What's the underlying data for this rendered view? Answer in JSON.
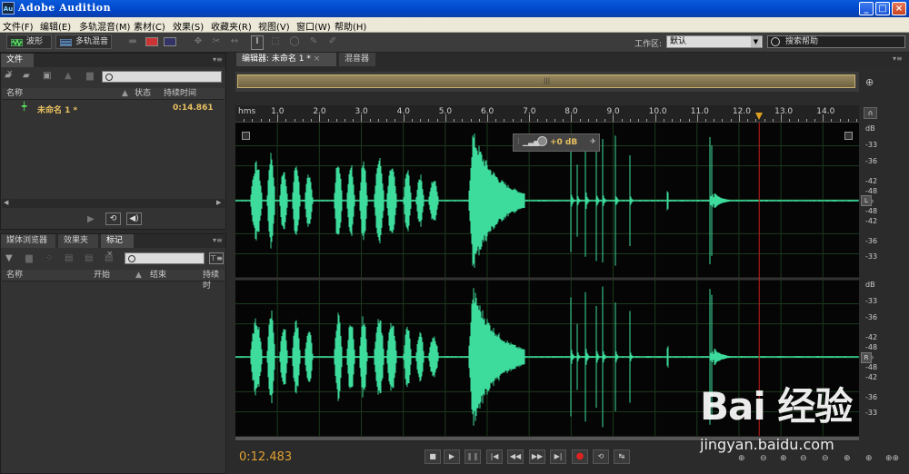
{
  "window": {
    "icon_text": "Au",
    "title": "Adobe Audition",
    "minimize_label": "_",
    "maximize_label": "□",
    "close_label": "×"
  },
  "menu": [
    "文件(F)",
    "编辑(E)",
    "多轨混音(M)",
    "素材(C)",
    "效果(S)",
    "收藏夹(R)",
    "视图(V)",
    "窗口(W)",
    "帮助(H)"
  ],
  "toolbar": {
    "waveform_label": "波形",
    "multitrack_label": "多轨混音",
    "workspace_label": "工作区:",
    "workspace_value": "默认",
    "help_search": "搜索帮助"
  },
  "files_panel": {
    "tab": "文件",
    "columns": [
      "名称",
      "状态",
      "持续时间"
    ],
    "items": [
      {
        "name": "未命名 1 *",
        "status": "",
        "duration": "0:14.861"
      }
    ]
  },
  "lower_panel": {
    "tabs": [
      "媒体浏览器",
      "效果夹",
      "标记"
    ],
    "active_tab": 2,
    "columns": [
      "名称",
      "开始",
      "结束",
      "持续时"
    ]
  },
  "editor": {
    "tabs": [
      "编辑器: 未命名 1 *",
      "混音器"
    ],
    "ruler_unit": "hms",
    "ruler_labels": [
      "1.0",
      "2.0",
      "3.0",
      "4.0",
      "5.0",
      "6.0",
      "7.0",
      "8.0",
      "9.0",
      "10.0",
      "11.0",
      "12.0",
      "13.0",
      "14.0"
    ],
    "duration_seconds": 14.861,
    "view_start_seconds": 0,
    "view_end_seconds": 14.861,
    "playhead_seconds": 12.483,
    "current_time": "0:12.483",
    "gain_hud": "+0 dB",
    "db_scale": [
      "dB",
      "-33",
      "-36",
      "-42",
      "-48",
      "-∞",
      "-48",
      "-42",
      "-36",
      "-33"
    ],
    "channels": [
      "L",
      "R"
    ],
    "colors": {
      "waveform": "#3ddc9c",
      "playhead": "#c81e1e",
      "playhead_marker": "#e0a020",
      "time_display": "#e0a030"
    }
  },
  "watermark": {
    "line1": "Bai 经验",
    "line2": "jingyan.baidu.com"
  }
}
